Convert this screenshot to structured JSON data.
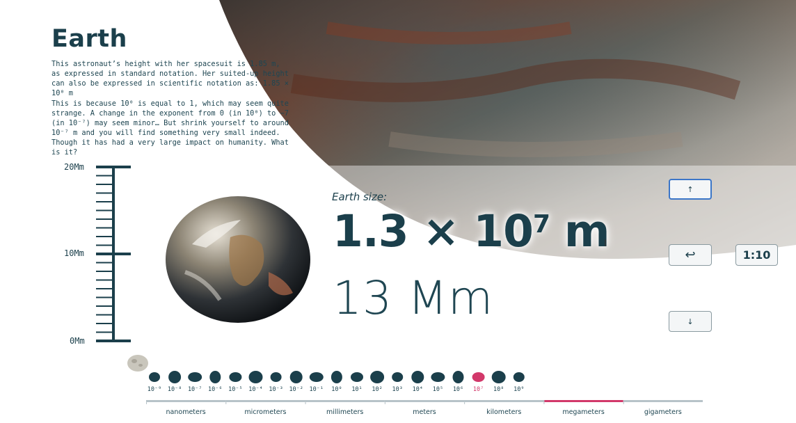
{
  "page": {
    "title": "Earth",
    "paragraph_1": "This astronaut’s height with her spacesuit is 1.85 m, as expressed in standard notation. Her suited-up height can also be expressed in scientific notation as: 1.85 × 10⁰ m",
    "paragraph_2": "This is because 10⁰ is equal to 1, which may seem quite strange. A change in the exponent from 0 (in 10⁰) to −7 (in 10⁻⁷) may seem minor… But shrink yourself to around 10⁻⁷ m and you will find something very small indeed. Though it has had a very large impact on humanity. What is it?"
  },
  "ruler": {
    "top_label": "20Mm",
    "mid_label": "10Mm",
    "bottom_label": "0Mm"
  },
  "readout": {
    "size_label": "Earth size:",
    "sci_mantissa": "1.3 × 10",
    "sci_exponent": "7",
    "sci_unit": " m",
    "standard": "13 Mm"
  },
  "controls": {
    "up_icon": "arrow-up-icon",
    "up_glyph": "↑",
    "back_icon": "return-icon",
    "back_glyph": "↩",
    "down_icon": "arrow-down-icon",
    "down_glyph": "↓",
    "ratio_label": "1:10"
  },
  "scale_bar": {
    "exponents": [
      "10⁻⁹",
      "10⁻⁸",
      "10⁻⁷",
      "10⁻⁶",
      "10⁻⁵",
      "10⁻⁴",
      "10⁻³",
      "10⁻²",
      "10⁻¹",
      "10⁰",
      "10¹",
      "10²",
      "10³",
      "10⁴",
      "10⁵",
      "10⁶",
      "10⁷",
      "10⁸",
      "10⁹"
    ],
    "active_exponent": "10⁷",
    "units": [
      "nanometers",
      "micrometers",
      "millimeters",
      "meters",
      "kilometers",
      "megameters",
      "gigameters"
    ],
    "active_unit": "megameters",
    "colors": {
      "track": "#b7c3c8",
      "active": "#d2386a",
      "ink": "#1b3f4b"
    }
  }
}
